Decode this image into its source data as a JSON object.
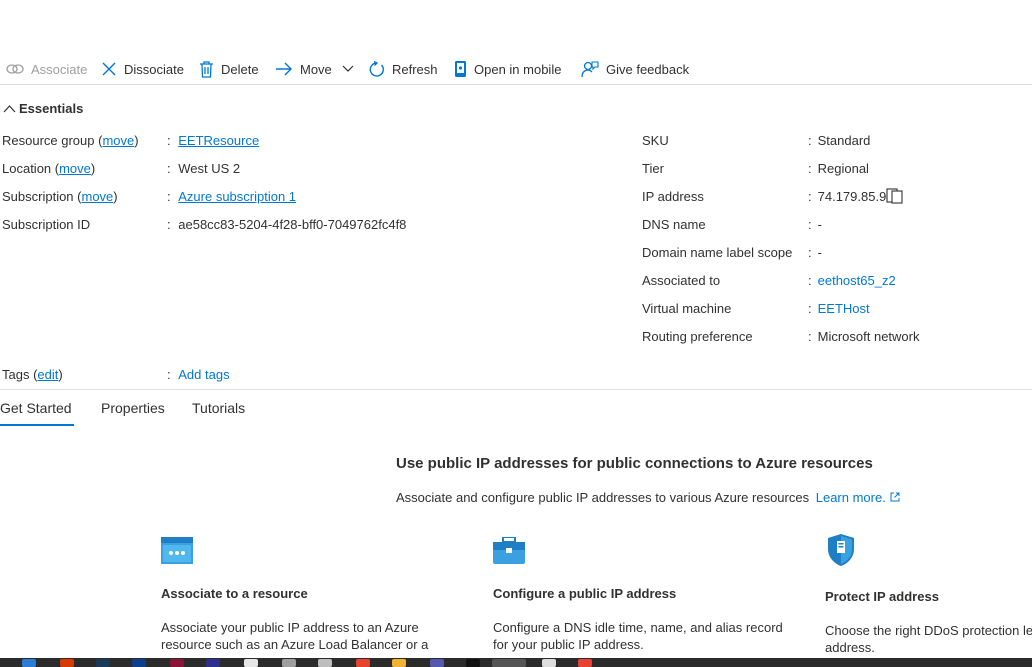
{
  "toolbar": {
    "associate": "Associate",
    "dissociate": "Dissociate",
    "delete": "Delete",
    "move": "Move",
    "refresh": "Refresh",
    "open_mobile": "Open in mobile",
    "feedback": "Give feedback"
  },
  "essentials": {
    "header": "Essentials",
    "left": {
      "resource_group_label": "Resource group (",
      "resource_group_move": "move",
      "resource_group_value": "EETResource",
      "location_label": "Location (",
      "location_move": "move",
      "location_value": "West US 2",
      "subscription_label": "Subscription (",
      "subscription_move": "move",
      "subscription_value": "Azure subscription 1",
      "subscription_id_label": "Subscription ID",
      "subscription_id_value": "ae58cc83-5204-4f28-bff0-7049762fc4f8"
    },
    "right": {
      "sku_label": "SKU",
      "sku_value": "Standard",
      "tier_label": "Tier",
      "tier_value": "Regional",
      "ip_label": "IP address",
      "ip_value": "74.179.85.9",
      "dns_label": "DNS name",
      "dns_value": "-",
      "dnsscope_label": "Domain name label scope",
      "dnsscope_value": "-",
      "assoc_label": "Associated to",
      "assoc_value": "eethost65_z2",
      "vm_label": "Virtual machine",
      "vm_value": "EETHost",
      "routing_label": "Routing preference",
      "routing_value": "Microsoft network"
    },
    "tags_label": "Tags (",
    "tags_edit": "edit",
    "tags_value": "Add tags",
    "colon": ":",
    "close_paren": ")"
  },
  "tabs": [
    "Get Started",
    "Properties",
    "Tutorials"
  ],
  "hero": {
    "title": "Use public IP addresses for public connections to Azure resources",
    "subtitle": "Associate and configure public IP addresses to various Azure resources",
    "learn_more": "Learn more."
  },
  "cards": [
    {
      "title": "Associate to a resource",
      "desc1": "Associate your public IP address to an Azure",
      "desc2": "resource such as an Azure Load Balancer or a"
    },
    {
      "title": "Configure a public IP address",
      "desc1": "Configure a DNS idle time, name, and alias record",
      "desc2": "for your public IP address."
    },
    {
      "title": "Protect IP address",
      "desc1": "Choose the right DDoS protection le",
      "desc2": "address."
    }
  ],
  "colors": {
    "accent": "#0078d4",
    "text": "#323130",
    "disabled": "#a19f9d",
    "taskbar": "#2b2b2b"
  }
}
